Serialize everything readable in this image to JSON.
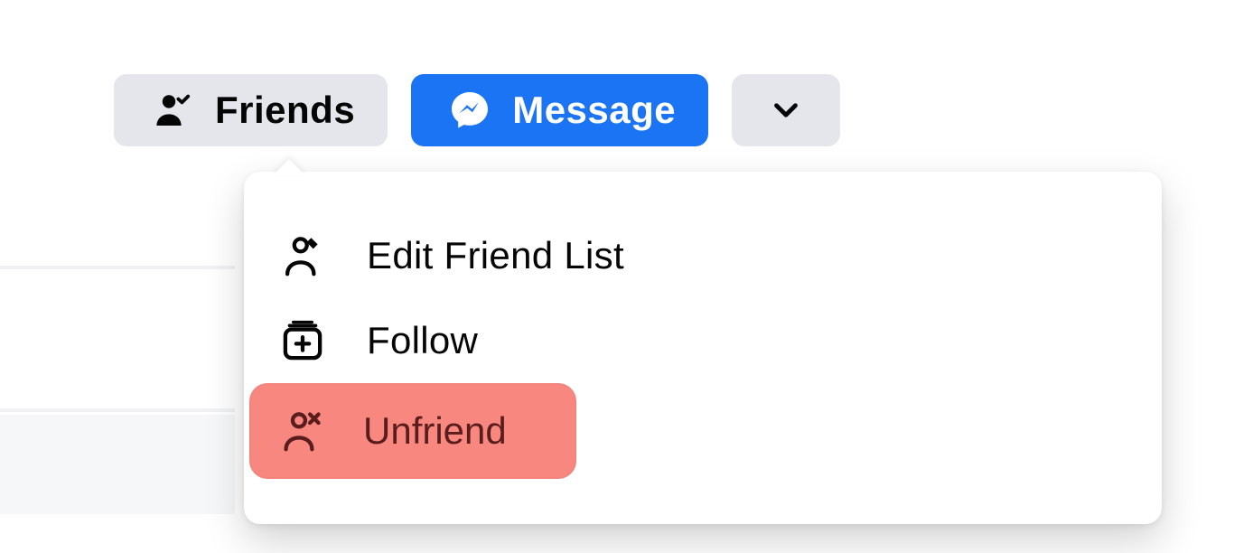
{
  "actions": {
    "friends_label": "Friends",
    "message_label": "Message"
  },
  "menu": {
    "edit_friend_list_label": "Edit Friend List",
    "follow_label": "Follow",
    "unfriend_label": "Unfriend"
  }
}
